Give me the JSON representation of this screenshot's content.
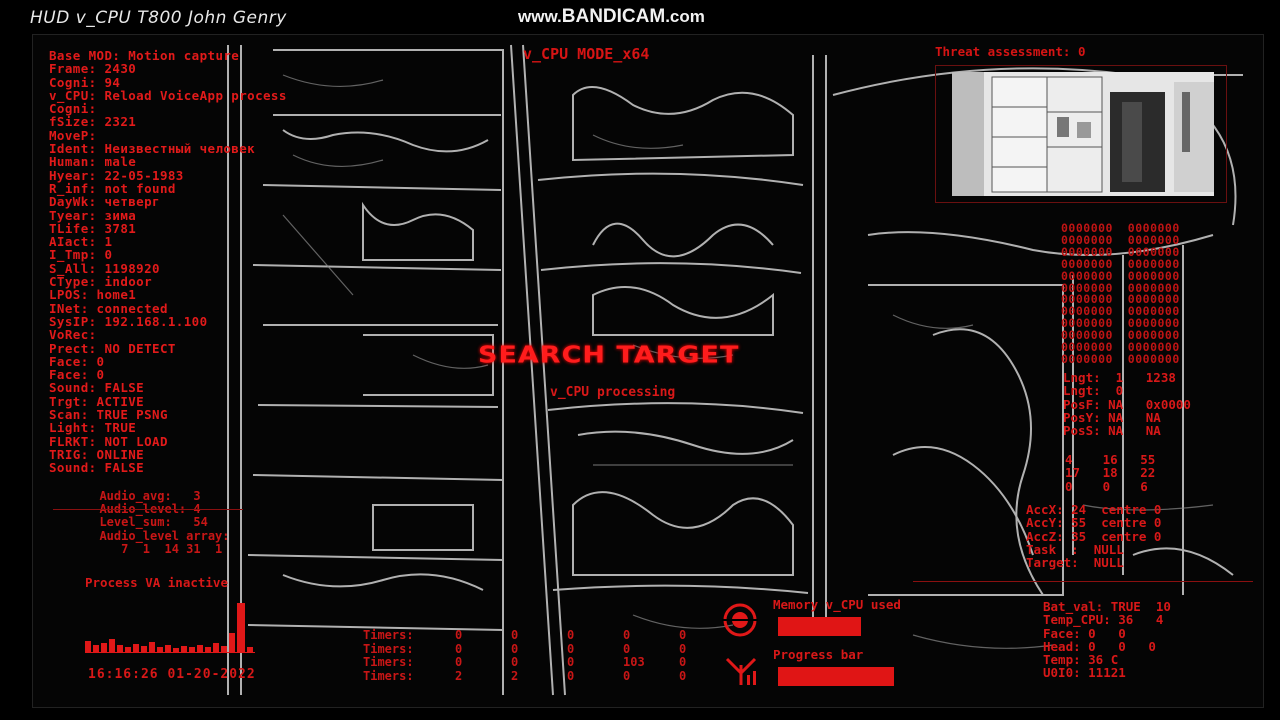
{
  "window": {
    "title": "HUD v_CPU T800 John Genry",
    "watermark_pre": "www.",
    "watermark_brand": "BANDICAM",
    "watermark_post": ".com"
  },
  "hud": {
    "mode": "v_CPU MODE_x64",
    "threat": "Threat assessment: 0",
    "center_title": "SEARCH TARGET",
    "center_sub": "v_CPU processing",
    "left_lines": [
      "Base MOD: Motion capture",
      "Frame: 2430",
      "Cogni: 94",
      "v_CPU: Reload VoiceApp process",
      "Cogni:",
      "fSize: 2321",
      "MoveP:",
      "Ident: Неизвестный человек",
      "Human: male",
      "Hyear: 22-05-1983",
      "R_inf: not found",
      "DayWk: четверг",
      "Tyear: зима",
      "TLife: 3781",
      "AIact: 1",
      "I_Tmp: 0",
      "S_All: 1198920",
      "CType: indoor",
      "LPOS: home1",
      "INet: connected",
      "SysIP: 192.168.1.100",
      "VoRec:",
      "Prect: NO DETECT",
      "Face: 0",
      "Face: 0",
      "Sound: FALSE",
      "Trgt: ACTIVE",
      "Scan: TRUE PSNG",
      "Light: TRUE",
      "FLRKT: NOT LOAD",
      "TRIG: ONLINE",
      "Sound: FALSE"
    ],
    "audio_lines": [
      "  Audio_avg:   3",
      "  Audio_level: 4",
      "  Level_sum:   54",
      "  Audio_level array:",
      "     7  1  14 31  1"
    ],
    "process_va": "Process VA inactive",
    "clock": "16:16:26  01-20-2022",
    "timers": [
      {
        "label": "Timers:",
        "vals": [
          "0",
          "0",
          "0",
          "0",
          "0"
        ]
      },
      {
        "label": "Timers:",
        "vals": [
          "0",
          "0",
          "0",
          "0",
          "0"
        ]
      },
      {
        "label": "Timers:",
        "vals": [
          "0",
          "0",
          "0",
          "103",
          "0"
        ]
      },
      {
        "label": "Timers:",
        "vals": [
          "2",
          "2",
          "0",
          "0",
          "0"
        ]
      }
    ],
    "memory_label": "Memory v_CPU used",
    "progress_label": "Progress bar",
    "binary_block": "0000000  0000000\n0000000  0000000\n0000000  0000000\n0000000  0000000\n0000000  0000000\n0000000  0000000\n0000000  0000000\n0000000  0000000\n0000000  0000000\n0000000  0000000\n0000000  0000000\n0000000  0000000",
    "right_block_1": "Lngt:  1   1238\nLngt:  0\nPosF: NA   0x0000\nPosY: NA   NA\nPosS: NA   NA",
    "right_block_2": "4    16   55\n17   18   22\n0    0    6",
    "right_block_3": "AccX: 24  centre 0\nAccY: 55  centre 0\nAccZ: 35  centre 0\nTask  :  NULL\nTarget:  NULL",
    "right_block_4": "Bat_val: TRUE  10\nTemp_CPU: 36   4\nFace: 0   0\nHead: 0   0   0\nTemp: 36 C\nU0I0: 11121"
  },
  "progress": {
    "memory_fill": 0.55,
    "progress_fill": 0.75
  },
  "colors": {
    "hud_red": "#e01818",
    "background": "#000000"
  }
}
